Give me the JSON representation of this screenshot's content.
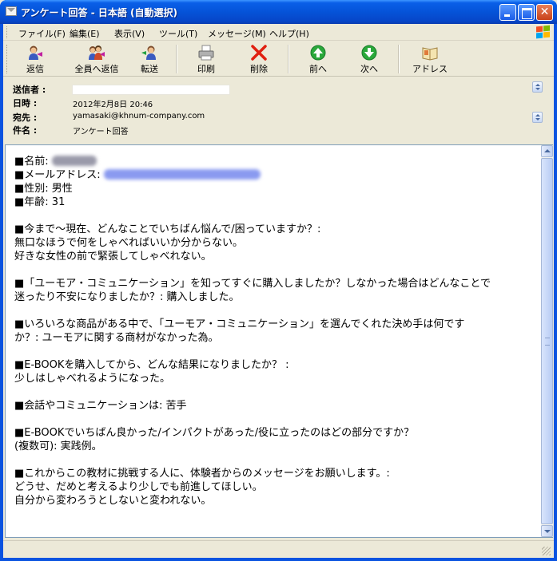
{
  "window": {
    "title": "アンケート回答 - 日本語 (自動選択)",
    "close_glyph": "✕"
  },
  "menu": [
    "ファイル(F)",
    "編集(E)",
    "表示(V)",
    "ツール(T)",
    "メッセージ(M)",
    "ヘルプ(H)"
  ],
  "toolbar": {
    "reply": "返信",
    "reply_all": "全員へ返信",
    "forward": "転送",
    "print": "印刷",
    "delete": "削除",
    "previous": "前へ",
    "next": "次へ",
    "addresses": "アドレス"
  },
  "header": {
    "from_label": "送信者 :",
    "date_label": "日時 :",
    "date_value": "2012年2月8日 20:46",
    "to_label": "宛先 :",
    "to_value": "yamasaki@khnum-company.com",
    "subject_label": "件名 :",
    "subject_value": "アンケート回答"
  },
  "body": {
    "name_label": "■名前:",
    "email_label": "■メールアドレス:",
    "gender": "■性別: 男性",
    "age": "■年齢: 31",
    "q1": "■今まで～現在、どんなことでいちばん悩んで/困っていますか？:",
    "a1_line1": "無口なほうで何をしゃべればいいか分からない。",
    "a1_line2": "好きな女性の前で緊張してしゃべれない。",
    "q2_line1": "■「ユーモア・コミュニケーション」を知ってすぐに購入しましたか？しなかった場合はどんなことで",
    "q2_line2": "迷ったり不安になりましたか？: 購入しました。",
    "q3_line1": "■いろいろな商品がある中で、「ユーモア・コミュニケーション」を選んでくれた決め手は何です",
    "q3_line2": "か？: ユーモアに関する商材がなかった為。",
    "q4": "■E-BOOKを購入してから、どんな結果になりましたか？ :",
    "a4": "少しはしゃべれるようになった。",
    "q5": "■会話やコミュニケーションは: 苦手",
    "q6": "■E-BOOKでいちばん良かった/インパクトがあった/役に立ったのはどの部分ですか？",
    "a6": "(複数可): 実践例。",
    "q7": "■これからこの教材に挑戦する人に、体験者からのメッセージをお願いします。:",
    "a7_line1": "どうせ、だめと考えるより少しでも前進してほしい。",
    "a7_line2": "自分から変わろうとしないと変われない。"
  },
  "colors": {
    "titlebar": "#0553d8",
    "window_bg": "#ece9d8",
    "body_bg": "#ffffff",
    "redacted_name": "#9a9aaa",
    "redacted_email": "#8a9af0"
  }
}
